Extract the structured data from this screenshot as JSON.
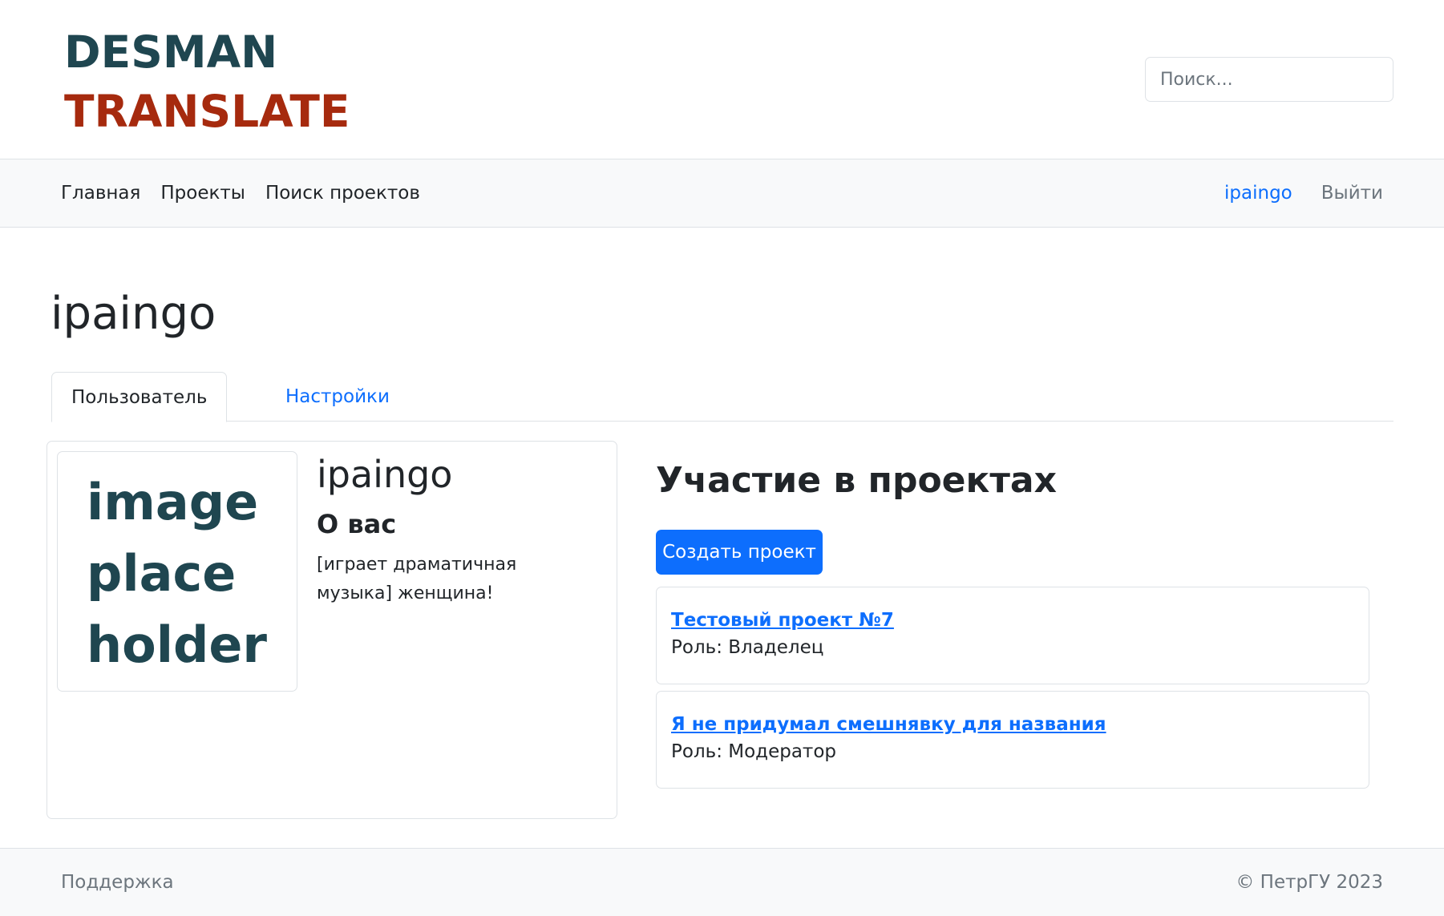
{
  "header": {
    "logo_line1": "DESMAN",
    "logo_line2": "TRANSLATE",
    "search_placeholder": "Поиск..."
  },
  "navbar": {
    "items": [
      {
        "label": "Главная"
      },
      {
        "label": "Проекты"
      },
      {
        "label": "Поиск проектов"
      }
    ],
    "user_label": "ipaingo",
    "logout_label": "Выйти"
  },
  "main": {
    "page_title": "ipaingo",
    "tabs": [
      {
        "label": "Пользователь",
        "active": true
      },
      {
        "label": "Настройки",
        "active": false
      }
    ],
    "profile": {
      "avatar_text_line1": "image",
      "avatar_text_line2": "place",
      "avatar_text_line3": "holder",
      "name": "ipaingo",
      "about_heading": "О вас",
      "about_text": "[играет драматичная музыка] женщина!"
    },
    "projects": {
      "heading": "Участие в проектах",
      "create_button_label": "Создать проект",
      "items": [
        {
          "title": "Тестовый проект №7",
          "role": "Роль: Владелец"
        },
        {
          "title": "Я не придумал смешнявку для названия",
          "role": "Роль: Модератор"
        }
      ]
    }
  },
  "footer": {
    "support_label": "Поддержка",
    "copyright": "© ПетрГУ 2023"
  },
  "colors": {
    "brand_dark": "#1f4650",
    "brand_accent": "#a62a0e",
    "primary": "#0d6efd",
    "muted": "#6c757d",
    "bar_bg": "#f8f9fa"
  }
}
